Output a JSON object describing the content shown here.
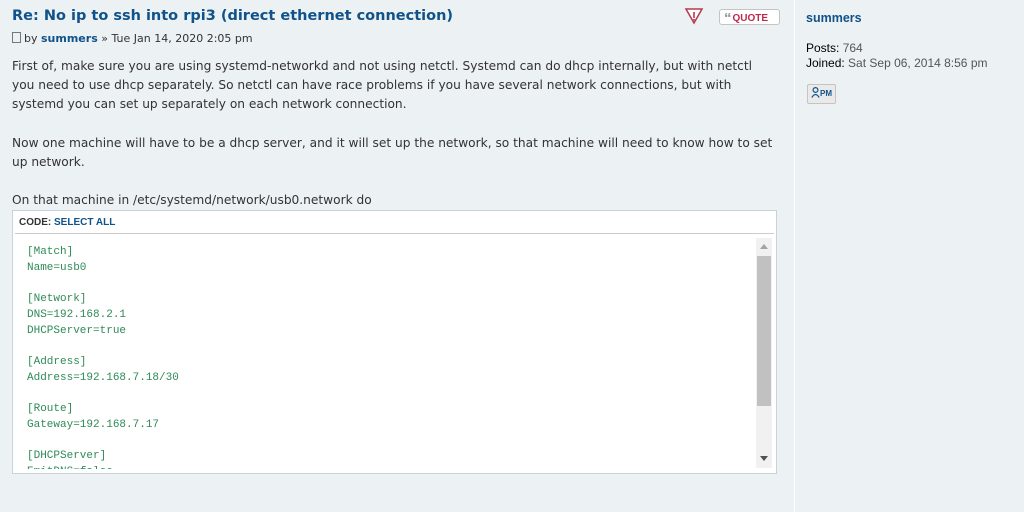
{
  "post": {
    "title": "Re: No ip to ssh into rpi3 (direct ethernet connection)",
    "by_label": "by",
    "author": "summers",
    "separator": "»",
    "date": "Tue Jan 14, 2020 2:05 pm",
    "report_icon": "report-warning-icon",
    "quote_label": "QUOTE",
    "paragraphs": [
      "First of, make sure you are using systemd-networkd and not using netctl. Systemd can do dhcp internally, but with netctl you need to use dhcp separately. So netctl can have race problems if you have several network connections, but with systemd you can set up separately on each network connection.",
      "Now one machine will have to be a dhcp server, and it will set up the network, so that machine will need to know how to set up network.",
      "On that machine in /etc/systemd/network/usb0.network do"
    ],
    "code": {
      "label": "CODE:",
      "select_all": "SELECT ALL",
      "content": "[Match]\nName=usb0\n\n[Network]\nDNS=192.168.2.1\nDHCPServer=true\n\n[Address]\nAddress=192.168.7.18/30\n\n[Route]\nGateway=192.168.7.17\n\n[DHCPServer]\nEmitDNS=false"
    }
  },
  "profile": {
    "username": "summers",
    "posts_label": "Posts:",
    "posts_value": "764",
    "joined_label": "Joined:",
    "joined_value": "Sat Sep 06, 2014 8:56 pm",
    "pm_label": "PM"
  },
  "colors": {
    "link": "#105289",
    "code_text": "#2e8b57",
    "quote_red": "#bc2a4d",
    "background": "#ecf1f3"
  }
}
